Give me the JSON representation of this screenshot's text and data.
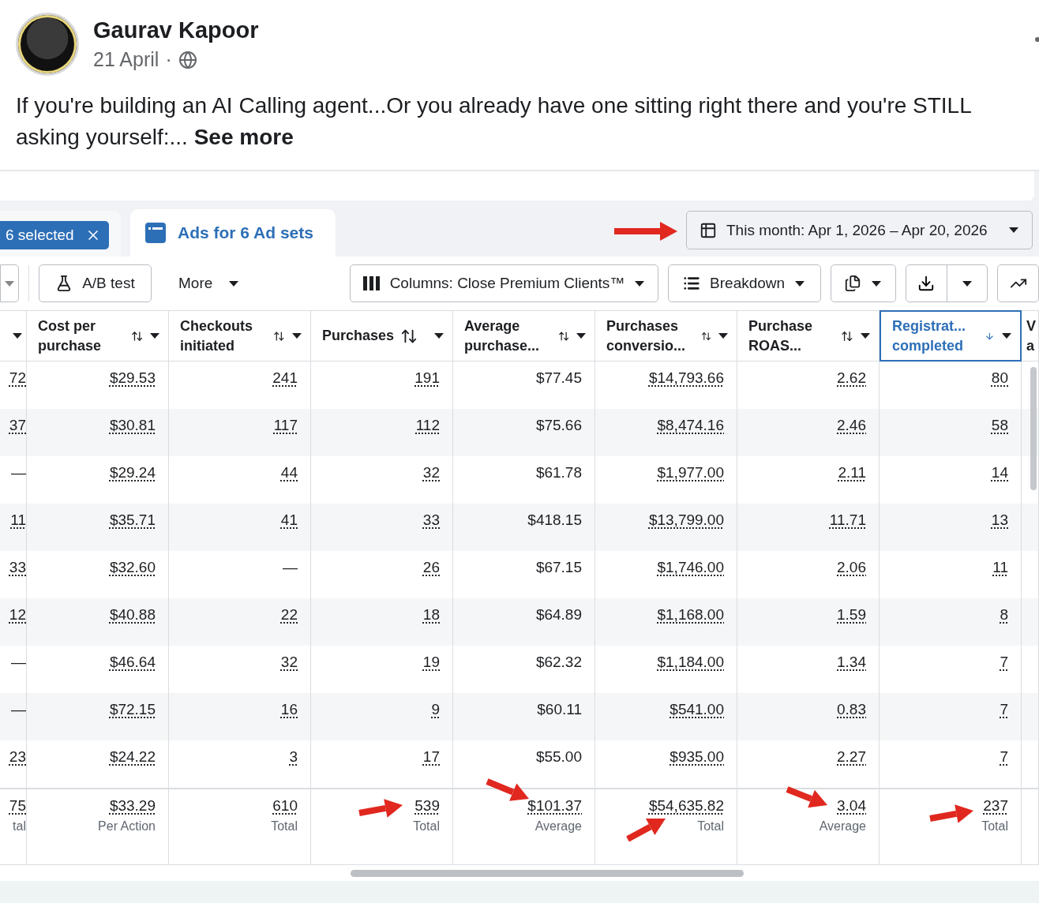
{
  "post": {
    "author": "Gaurav Kapoor",
    "date": "21 April",
    "separator": "·",
    "text": "If you're building an AI Calling agent...Or you already have one sitting right there and you're STILL asking yourself:...",
    "see_more": "See more"
  },
  "tabs": {
    "chip": "6 selected",
    "items": [
      {
        "label": "Ads for 6 Ad sets",
        "selected": true
      }
    ]
  },
  "date_range": "This month: Apr 1, 2026 – Apr 20, 2026",
  "toolbar": {
    "ab_test": "A/B test",
    "more": "More",
    "columns": "Columns: Close Premium Clients™",
    "breakdown": "Breakdown"
  },
  "table": {
    "columns": [
      {
        "sortable": false,
        "menu": true,
        "selected": false,
        "dotted": true
      },
      {
        "label": "Cost per purchase",
        "sortable": true,
        "menu": true,
        "selected": false,
        "dotted": true
      },
      {
        "label": "Checkouts initiated",
        "sortable": true,
        "menu": true,
        "selected": false,
        "dotted": true
      },
      {
        "label": "Purchases",
        "sortable": true,
        "menu": true,
        "selected": false,
        "dotted": true
      },
      {
        "label": "Average purchase...",
        "sortable": true,
        "menu": true,
        "selected": false,
        "dotted": false
      },
      {
        "label": "Purchases conversio...",
        "sortable": true,
        "menu": true,
        "selected": false,
        "dotted": true
      },
      {
        "label": "Purchase ROAS...",
        "sortable": true,
        "menu": true,
        "selected": false,
        "dotted": true
      },
      {
        "label": "Registrat... completed",
        "sortable": true,
        "menu": true,
        "selected": true,
        "dotted": true
      },
      {
        "label": "V a",
        "sortable": false,
        "menu": false,
        "selected": false
      }
    ],
    "rows": [
      [
        "72",
        "$29.53",
        "241",
        "191",
        "$77.45",
        "$14,793.66",
        "2.62",
        "80"
      ],
      [
        "37",
        "$30.81",
        "117",
        "112",
        "$75.66",
        "$8,474.16",
        "2.46",
        "58"
      ],
      [
        {
          "text": "—",
          "dotted": false
        },
        "$29.24",
        "44",
        "32",
        "$61.78",
        "$1,977.00",
        "2.11",
        "14"
      ],
      [
        "11",
        "$35.71",
        "41",
        "33",
        "$418.15",
        "$13,799.00",
        "11.71",
        "13"
      ],
      [
        "33",
        "$32.60",
        {
          "text": "—",
          "dotted": false
        },
        "26",
        "$67.15",
        "$1,746.00",
        "2.06",
        "11"
      ],
      [
        "12",
        "$40.88",
        "22",
        "18",
        "$64.89",
        "$1,168.00",
        "1.59",
        "8"
      ],
      [
        {
          "text": "—",
          "dotted": false
        },
        "$46.64",
        "32",
        "19",
        "$62.32",
        "$1,184.00",
        "1.34",
        "7"
      ],
      [
        {
          "text": "—",
          "dotted": false
        },
        "$72.15",
        "16",
        "9",
        "$60.11",
        "$541.00",
        "0.83",
        "7"
      ],
      [
        "23",
        "$24.22",
        "3",
        "17",
        "$55.00",
        "$935.00",
        "2.27",
        "7"
      ]
    ],
    "totals": [
      {
        "value": "75",
        "sub": "tal"
      },
      {
        "value": "$33.29",
        "sub": "Per Action"
      },
      {
        "value": "610",
        "sub": "Total"
      },
      {
        "value": "539",
        "sub": "Total"
      },
      {
        "value": "$101.37",
        "sub": "Average"
      },
      {
        "value": "$54,635.82",
        "sub": "Total"
      },
      {
        "value": "3.04",
        "sub": "Average"
      },
      {
        "value": "237",
        "sub": "Total"
      }
    ]
  }
}
